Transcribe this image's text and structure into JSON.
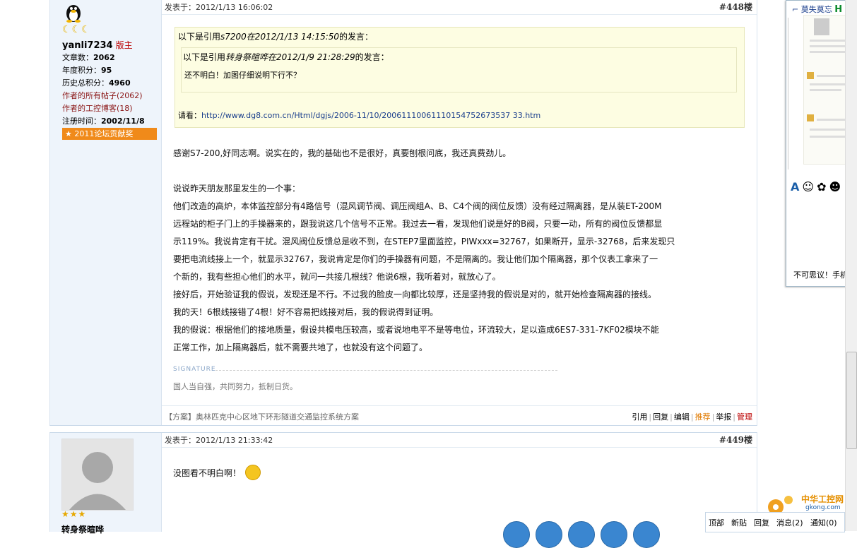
{
  "post1": {
    "time": "发表于：2012/1/13 16:06:02",
    "floor": "#448楼",
    "user": {
      "name": "yanli7234",
      "role": "版主",
      "stats": [
        {
          "label": "文章数：",
          "value": "2062"
        },
        {
          "label": "年度积分：",
          "value": "95"
        },
        {
          "label": "历史总积分：",
          "value": "4960"
        }
      ],
      "link_posts": "作者的所有帖子(2062)",
      "link_blog": "作者的工控博客(18)",
      "reg": {
        "label": "注册时间：",
        "value": "2002/11/8"
      },
      "badge": "2011论坛贡献奖"
    },
    "quote": {
      "line1_prefix": "以下是引用",
      "line1_quote": "s7200在2012/1/13 14:15:50",
      "line1_suffix": "的发言：",
      "inner_prefix": "以下是引用",
      "inner_quote": "转身祭暄哗在2012/1/9 21:28:29",
      "inner_suffix": "的发言：",
      "inner_text": "还不明白！加图仔细说明下行不？",
      "link_label": "请看：",
      "link_url": "http://www.dg8.com.cn/Html/dgjs/2006-11/10/20061110061110154752673537 33.htm"
    },
    "body": {
      "p1": "感谢S7-200,好同志啊。说实在的，我的基础也不是很好，真要刨根问底，我还真费劲儿。",
      "p2": "说说昨天朋友那里发生的一个事：",
      "p3a": "他们改造的高炉，本体监控部分有4路信号（混风调节阀、调压阀组A、B、C4个阀的阀位反馈）没有经过隔离器，是从装ET-200M",
      "p3b": "远程站的柜子门上的手操器来的，跟我说这几个信号不正常。我过去一看，发现他们说是好的B阀，只要一动，所有的阀位反馈都显",
      "p3c": "示119%。我说肯定有干扰。混风阀位反馈总是收不到，在STEP7里面监控，PIWxxx=32767，如果断开，显示-32768，后来发现只",
      "p3d": "要把电流线接上一个，就显示32767，我说肯定是你们的手操器有问题，不是隔离的。我让他们加个隔离器，那个仪表工拿来了一",
      "p3e": "个新的，我有些担心他们的水平，就问一共接几根线？他说6根，我听着对，就放心了。",
      "p4": "接好后，开始验证我的假说，发现还是不行。不过我的脸皮一向都比较厚，还是坚持我的假说是对的，就开始检查隔离器的接线。",
      "p5": "我的天！6根线接错了4根！好不容易把线接对后，我的假说得到证明。",
      "p6a": "我的假说：根据他们的接地质量，假设共模电压较高，或者说地电平不是等电位，环流较大，足以造成6ES7-331-7KF02模块不能",
      "p6b": "正常工作，加上隔离器后，就不需要共地了，也就没有这个问题了。"
    },
    "signature_label": "SIGNATURE",
    "signature": "国人当自强，共同努力，抵制日货。",
    "promo": "【方案】奥林匹克中心区地下环形隧道交通监控系统方案",
    "actions": [
      "引用",
      "回复",
      "编辑",
      "推荐",
      "举报",
      "管理"
    ]
  },
  "post2": {
    "time": "发表于：2012/1/13 21:33:42",
    "floor": "#449楼",
    "text": "没图看不明白啊！",
    "user_name": "转身祭暄哗"
  },
  "side_window": {
    "title": "莫失莫忘",
    "title_suffix": "H",
    "bottom_text": "不可思议！手机上"
  },
  "bottom_bar": [
    "顶部",
    "新贴",
    "回复",
    "消息(2)",
    "通知(0)"
  ],
  "logo": {
    "name": "中华工控网",
    "domain": "gkong.com"
  },
  "colors": {
    "accent_orange": "#f08a1a",
    "link_blue": "#1a3e8c",
    "quote_bg": "#fdfde2",
    "sidebar_bg": "#eef4fb"
  }
}
